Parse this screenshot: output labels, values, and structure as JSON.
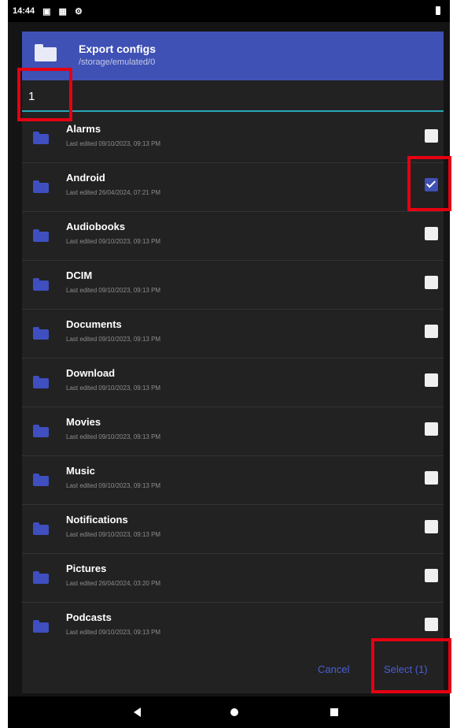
{
  "status_bar": {
    "time": "14:44",
    "icons": [
      "notification-icon",
      "grid-icon",
      "settings-icon"
    ]
  },
  "dialog": {
    "title": "Export configs",
    "path": "/storage/emulated/0",
    "search_value": "1",
    "items": [
      {
        "name": "Alarms",
        "modified": "Last edited 09/10/2023, 09:13 PM",
        "checked": false
      },
      {
        "name": "Android",
        "modified": "Last edited 26/04/2024, 07:21 PM",
        "checked": true
      },
      {
        "name": "Audiobooks",
        "modified": "Last edited 09/10/2023, 09:13 PM",
        "checked": false
      },
      {
        "name": "DCIM",
        "modified": "Last edited 09/10/2023, 09:13 PM",
        "checked": false
      },
      {
        "name": "Documents",
        "modified": "Last edited 09/10/2023, 09:13 PM",
        "checked": false
      },
      {
        "name": "Download",
        "modified": "Last edited 09/10/2023, 09:13 PM",
        "checked": false
      },
      {
        "name": "Movies",
        "modified": "Last edited 09/10/2023, 09:13 PM",
        "checked": false
      },
      {
        "name": "Music",
        "modified": "Last edited 09/10/2023, 09:13 PM",
        "checked": false
      },
      {
        "name": "Notifications",
        "modified": "Last edited 09/10/2023, 09:13 PM",
        "checked": false
      },
      {
        "name": "Pictures",
        "modified": "Last edited 26/04/2024, 03:20 PM",
        "checked": false
      },
      {
        "name": "Podcasts",
        "modified": "Last edited 09/10/2023, 09:13 PM",
        "checked": false
      }
    ],
    "cancel_label": "Cancel",
    "select_label": "Select (1)"
  },
  "colors": {
    "header": "#3f51b5",
    "folder_icon": "#3f4fc0",
    "accent_line": "#26a6b8",
    "highlight": "#e50012"
  }
}
